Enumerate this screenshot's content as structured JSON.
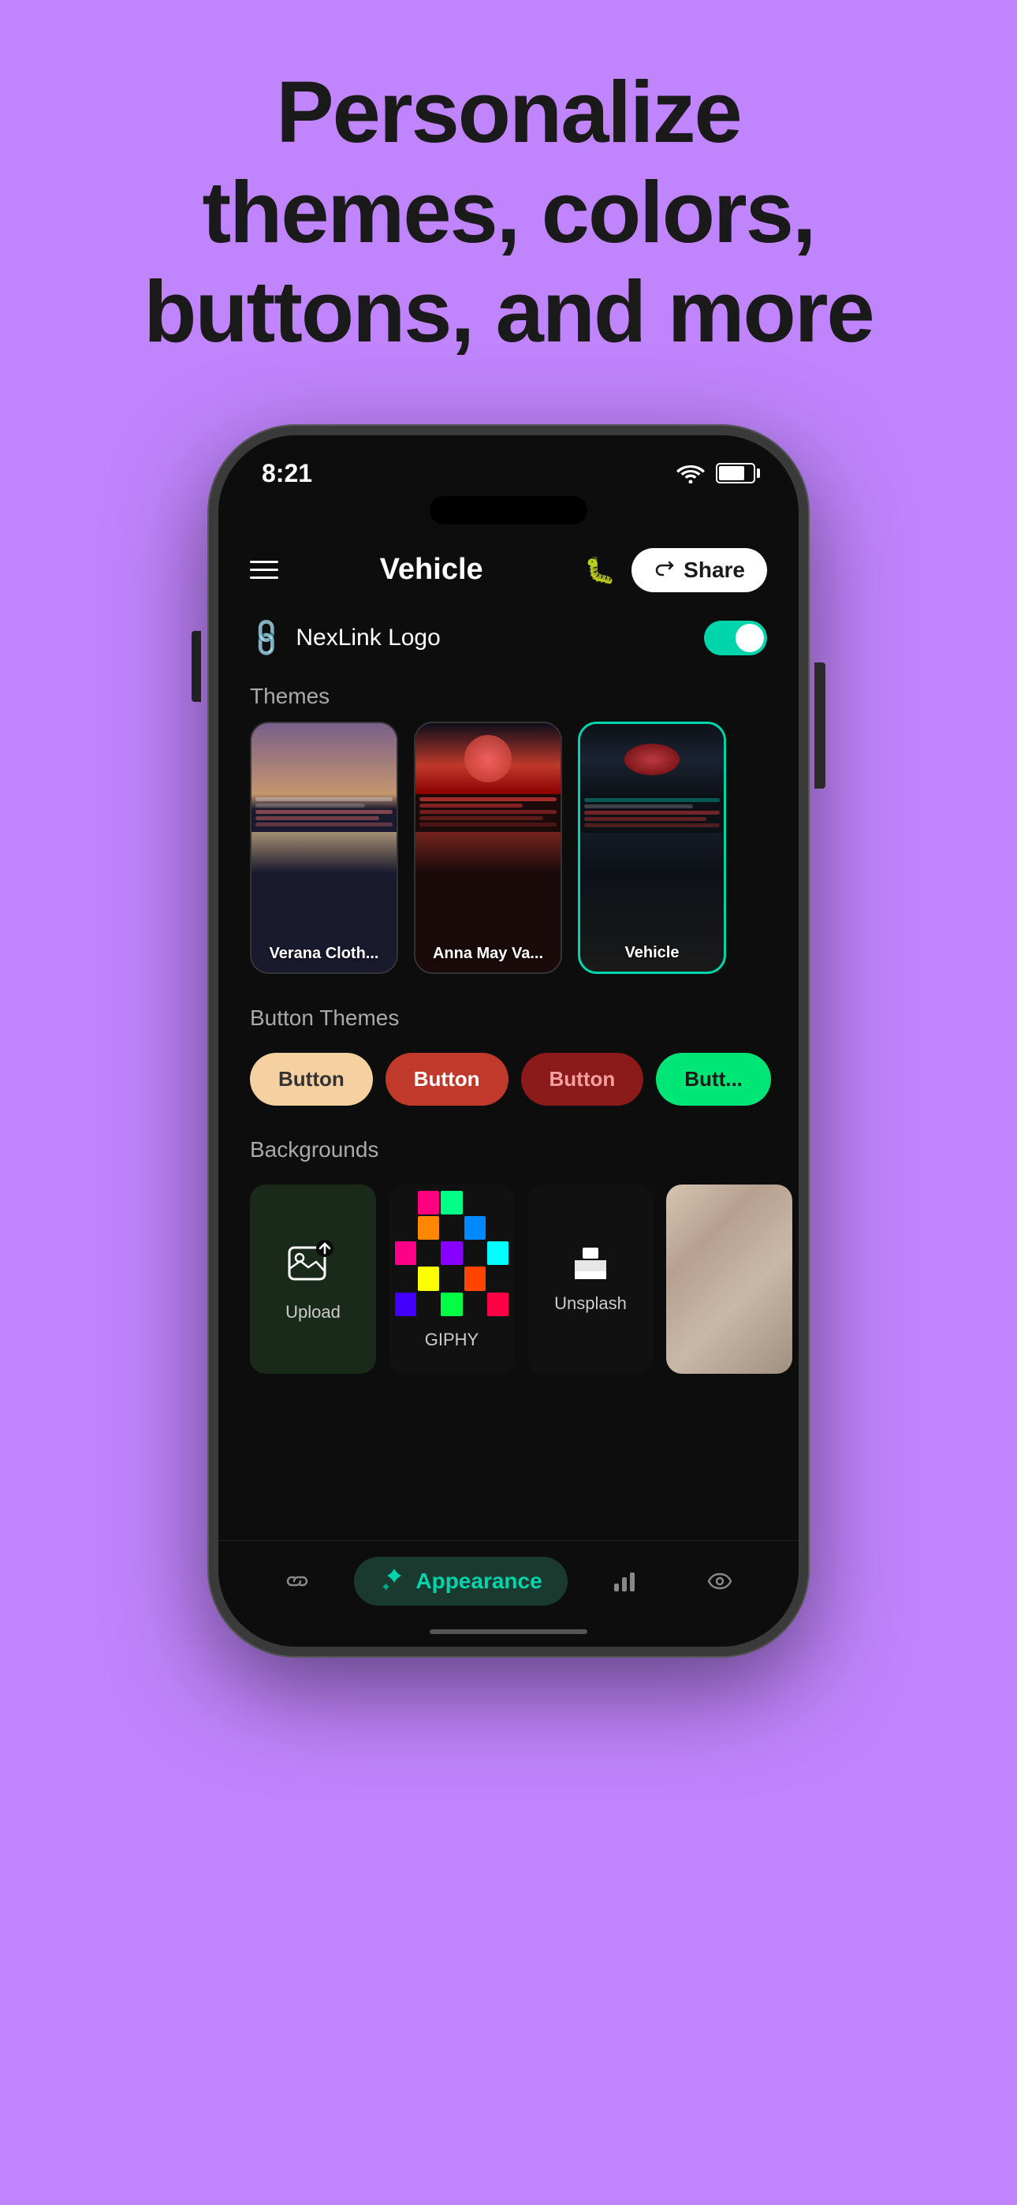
{
  "hero": {
    "line1": "Personalize",
    "line2": "themes, colors,",
    "line3": "buttons, and more"
  },
  "status_bar": {
    "time": "8:21",
    "wifi": "wifi",
    "battery": "battery"
  },
  "header": {
    "title": "Vehicle",
    "share_label": "Share"
  },
  "nexlink": {
    "label": "NexLink Logo"
  },
  "sections": {
    "themes_label": "Themes",
    "button_themes_label": "Button Themes",
    "backgrounds_label": "Backgrounds"
  },
  "themes": [
    {
      "label": "Verana Cloth...",
      "id": "verana"
    },
    {
      "label": "Anna May Va...",
      "id": "anna"
    },
    {
      "label": "Vehicle",
      "id": "vehicle",
      "selected": true
    }
  ],
  "button_themes": [
    {
      "label": "Button",
      "style": "peach"
    },
    {
      "label": "Button",
      "style": "red"
    },
    {
      "label": "Button",
      "style": "dark-red"
    },
    {
      "label": "Butt...",
      "style": "green"
    }
  ],
  "backgrounds": [
    {
      "label": "Upload",
      "type": "upload"
    },
    {
      "label": "GIPHY",
      "type": "giphy"
    },
    {
      "label": "Unsplash",
      "type": "unsplash"
    },
    {
      "label": "",
      "type": "marble"
    }
  ],
  "nav": {
    "items": [
      {
        "icon": "link",
        "label": "",
        "active": false
      },
      {
        "icon": "sparkle",
        "label": "Appearance",
        "active": true
      },
      {
        "icon": "chart",
        "label": "",
        "active": false
      },
      {
        "icon": "eye",
        "label": "",
        "active": false
      }
    ]
  }
}
